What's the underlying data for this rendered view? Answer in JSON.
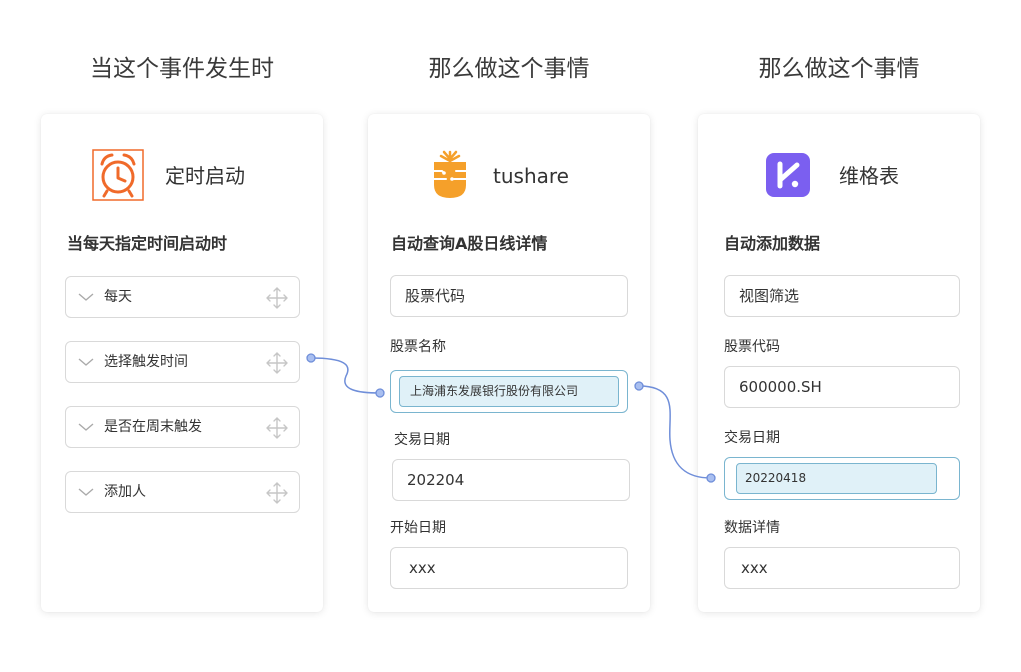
{
  "columns": [
    {
      "header": "当这个事件发生时"
    },
    {
      "header": "那么做这个事情"
    },
    {
      "header": "那么做这个事情"
    }
  ],
  "timer_card": {
    "app_name": "定时启动",
    "subtitle": "当每天指定时间启动时",
    "options": [
      {
        "label": "每天"
      },
      {
        "label": "选择触发时间"
      },
      {
        "label": "是否在周末触发"
      },
      {
        "label": "添加人"
      }
    ]
  },
  "tushare_card": {
    "app_name": "tushare",
    "subtitle": "自动查询A股日线详情",
    "stock_code_value": "股票代码",
    "stock_name_label": "股票名称",
    "stock_name_chip": "上海浦东发展银行股份有限公司",
    "trade_date_label": "交易日期",
    "trade_date_value": "202204",
    "start_date_label": "开始日期",
    "start_date_value": "xxx"
  },
  "vika_card": {
    "app_name": "维格表",
    "subtitle": "自动添加数据",
    "view_filter_value": "视图筛选",
    "stock_code_label": "股票代码",
    "stock_code_value": "600000.SH",
    "trade_date_label": "交易日期",
    "trade_date_chip": "20220418",
    "detail_label": "数据详情",
    "detail_value": "xxx"
  },
  "colors": {
    "timer_orange": "#f06a2a",
    "tushare_orange": "#f5a02a",
    "vika_purple": "#7b5ff0",
    "connector": "#6f8ed9",
    "chip_bg": "#e0f1f8",
    "chip_border": "#7ab5cf"
  },
  "icons": {
    "timer": "alarm-clock-icon",
    "tushare": "carrot-icon",
    "vika": "vika-logo-icon",
    "chevron": "chevron-down-icon",
    "move": "move-arrows-icon"
  }
}
